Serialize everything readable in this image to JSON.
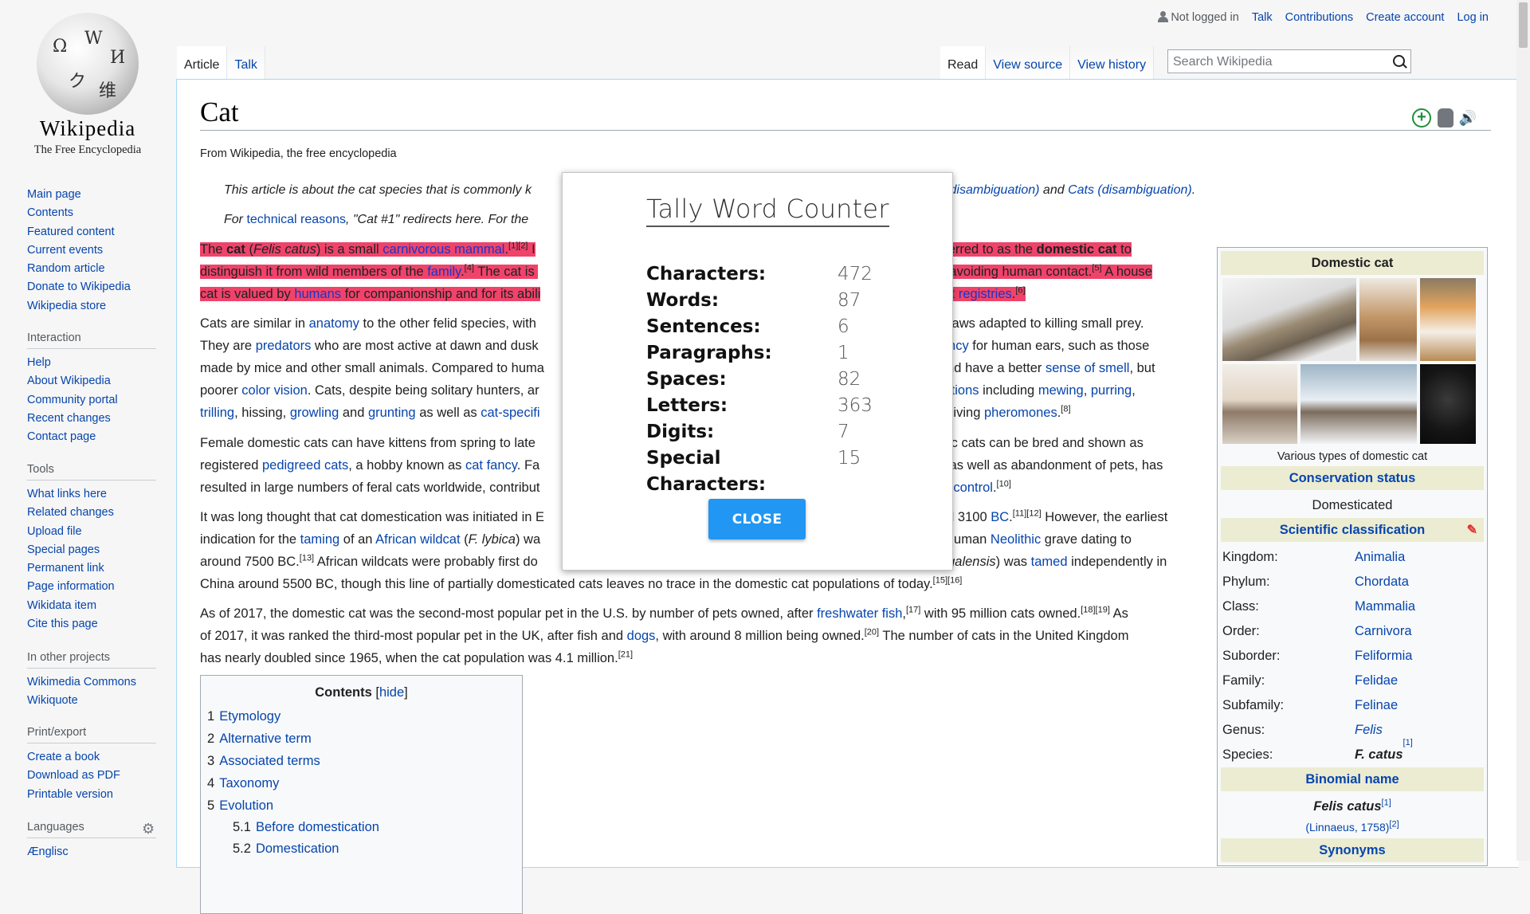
{
  "logo": {
    "wordmark": "Wikipedia",
    "tagline": "The Free Encyclopedia"
  },
  "sidebar": {
    "navigation": [
      "Main page",
      "Contents",
      "Featured content",
      "Current events",
      "Random article",
      "Donate to Wikipedia",
      "Wikipedia store"
    ],
    "interaction": {
      "heading": "Interaction",
      "items": [
        "Help",
        "About Wikipedia",
        "Community portal",
        "Recent changes",
        "Contact page"
      ]
    },
    "tools": {
      "heading": "Tools",
      "items": [
        "What links here",
        "Related changes",
        "Upload file",
        "Special pages",
        "Permanent link",
        "Page information",
        "Wikidata item",
        "Cite this page"
      ]
    },
    "projects": {
      "heading": "In other projects",
      "items": [
        "Wikimedia Commons",
        "Wikiquote"
      ]
    },
    "print": {
      "heading": "Print/export",
      "items": [
        "Create a book",
        "Download as PDF",
        "Printable version"
      ]
    },
    "languages": {
      "heading": "Languages",
      "items": [
        "Ænglisc"
      ]
    }
  },
  "personal": {
    "status": "Not logged in",
    "talk": "Talk",
    "contributions": "Contributions",
    "create": "Create account",
    "login": "Log in"
  },
  "tabs": {
    "article": "Article",
    "talk": "Talk",
    "read": "Read",
    "view_source": "View source",
    "view_history": "View history"
  },
  "search": {
    "placeholder": "Search Wikipedia"
  },
  "page": {
    "title": "Cat",
    "tagline": "From Wikipedia, the free encyclopedia",
    "hatnote1_a": "This article is about the cat species that is commonly k",
    "hatnote1_b": "Cat (disambiguation)",
    "hatnote1_c": " and ",
    "hatnote1_d": "Cats (disambiguation)",
    "hatnote1_e": ".",
    "hatnote2_a": "For ",
    "hatnote2_b": "technical reasons",
    "hatnote2_c": ", \"Cat #1\" redirects here. For the"
  },
  "modal": {
    "title": "Tally Word Counter",
    "stats": [
      {
        "label": "Characters:",
        "value": "472"
      },
      {
        "label": "Words:",
        "value": "87"
      },
      {
        "label": "Sentences:",
        "value": "6"
      },
      {
        "label": "Paragraphs:",
        "value": "1"
      },
      {
        "label": "Spaces:",
        "value": "82"
      },
      {
        "label": "Letters:",
        "value": "363"
      },
      {
        "label": "Digits:",
        "value": "7"
      },
      {
        "label": "Special Characters:",
        "value": "15"
      }
    ],
    "close_label": "CLOSE"
  },
  "infobox": {
    "title": "Domestic cat",
    "caption": "Various types of domestic cat",
    "conservation_heading": "Conservation status",
    "conservation_value": "Domesticated",
    "classification_heading": "Scientific classification",
    "rows": [
      {
        "k": "Kingdom:",
        "v": "Animalia"
      },
      {
        "k": "Phylum:",
        "v": "Chordata"
      },
      {
        "k": "Class:",
        "v": "Mammalia"
      },
      {
        "k": "Order:",
        "v": "Carnivora"
      },
      {
        "k": "Suborder:",
        "v": "Feliformia"
      },
      {
        "k": "Family:",
        "v": "Felidae"
      },
      {
        "k": "Subfamily:",
        "v": "Felinae"
      },
      {
        "k": "Genus:",
        "v": "Felis"
      },
      {
        "k": "Species:",
        "v": "F. catus"
      }
    ],
    "binomial_heading": "Binomial name",
    "binomial_value": "Felis catus",
    "authority": "(Linnaeus, 1758)",
    "synonyms_heading": "Synonyms"
  },
  "toc": {
    "title": "Contents",
    "hide": "hide",
    "items": [
      {
        "n": "1",
        "t": "Etymology"
      },
      {
        "n": "2",
        "t": "Alternative term"
      },
      {
        "n": "3",
        "t": "Associated terms"
      },
      {
        "n": "4",
        "t": "Taxonomy"
      },
      {
        "n": "5",
        "t": "Evolution"
      },
      {
        "n": "5.1",
        "t": "Before domestication"
      },
      {
        "n": "5.2",
        "t": "Domestication"
      }
    ]
  },
  "colors": {
    "highlight": "#f0436a",
    "link": "#0645ad",
    "button": "#2196f3"
  }
}
